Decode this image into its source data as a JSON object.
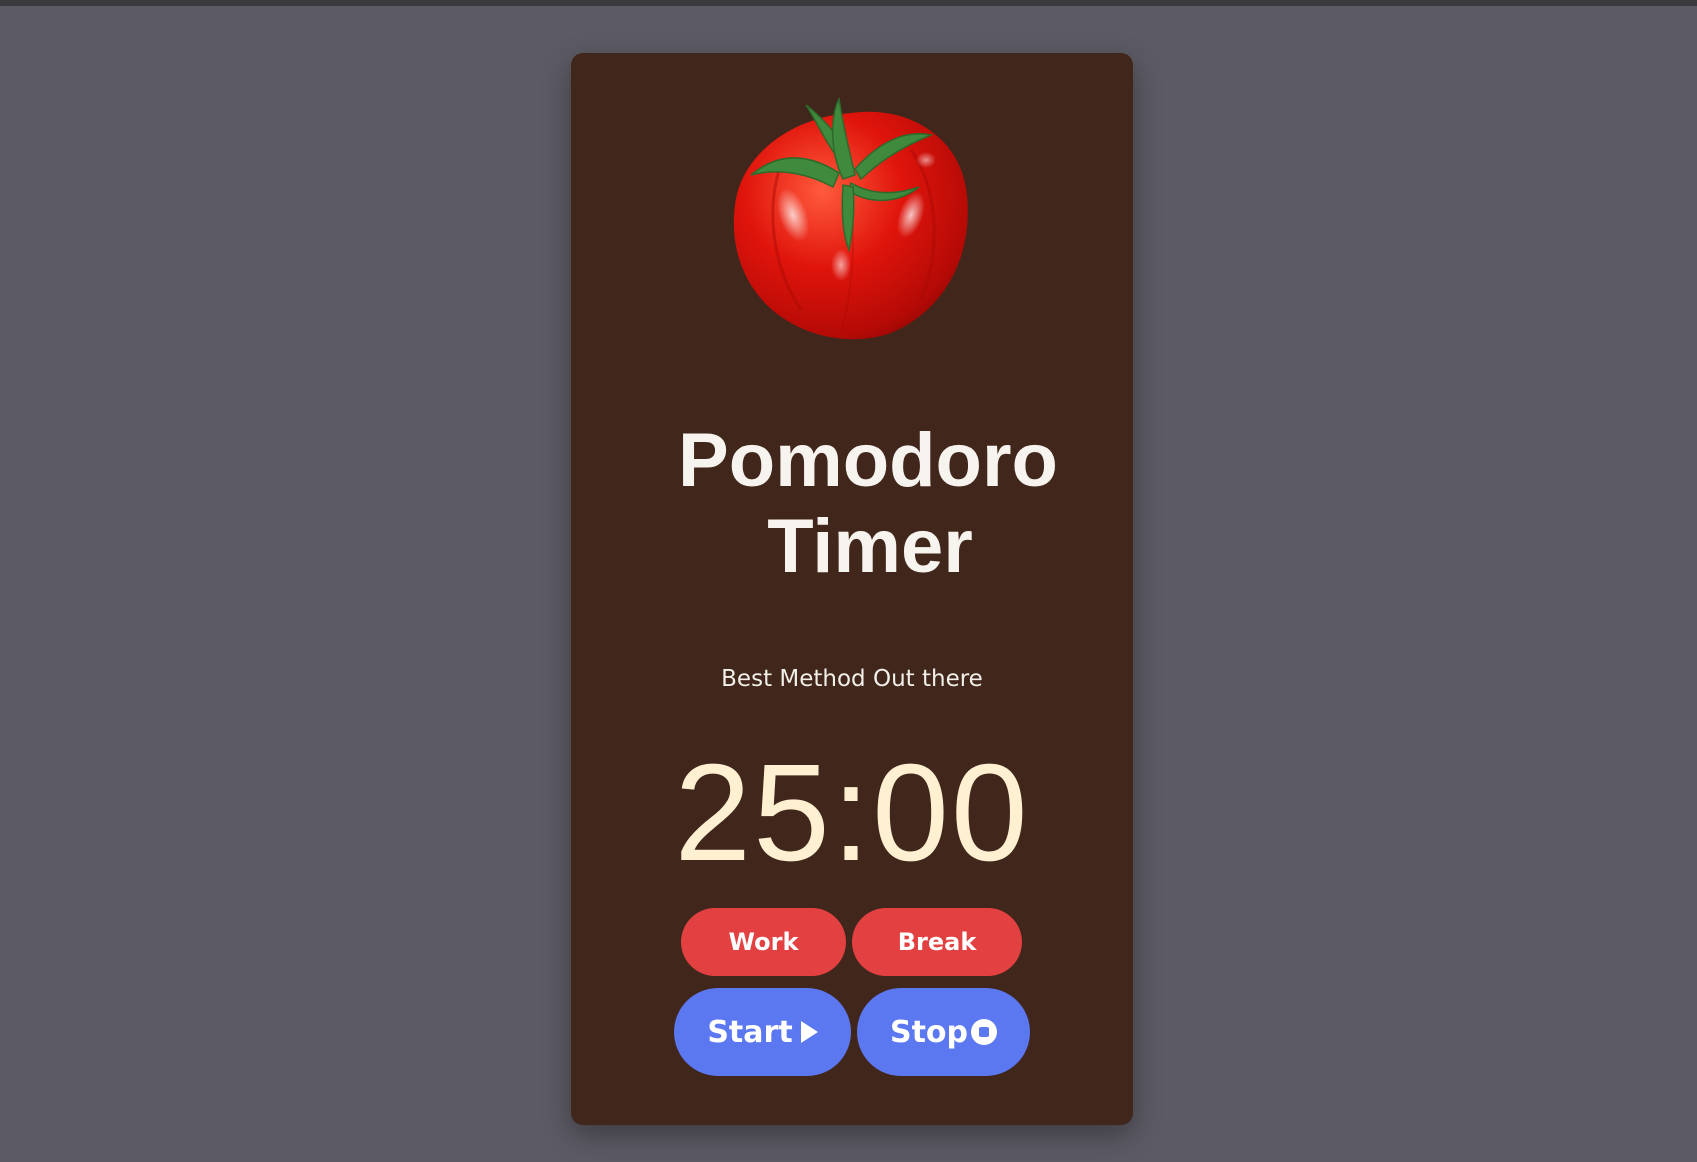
{
  "app": {
    "title_line1": "Pomodoro",
    "title_line2": "Timer",
    "subtitle": "Best Method Out there",
    "timer_display": "25:00"
  },
  "modes": {
    "work_label": "Work",
    "break_label": "Break"
  },
  "controls": {
    "start_label": "Start",
    "stop_label": "Stop",
    "start_icon": "play-icon",
    "stop_icon": "stop-circle-icon"
  },
  "colors": {
    "page_background": "#5c5b65",
    "card_background": "#40261b",
    "mode_button": "#e34042",
    "control_button": "#5c78f0",
    "timer_text": "#fff0d2"
  }
}
